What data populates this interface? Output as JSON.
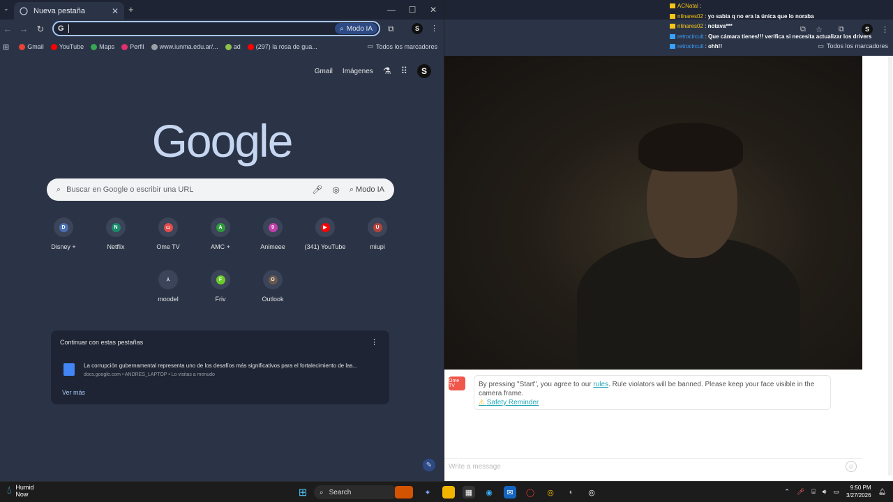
{
  "left_window": {
    "tab_title": "Nueva pestaña",
    "new_tab": "+",
    "omnibox_value": "",
    "omnibox_modo": "Modo IA",
    "bookmarks": [
      {
        "label": "Gmail",
        "color": "#ea4335"
      },
      {
        "label": "YouTube",
        "color": "#ff0000"
      },
      {
        "label": "Maps",
        "color": "#34a853"
      },
      {
        "label": "Perfil",
        "color": "#e1306c"
      },
      {
        "label": "www.iunma.edu.ar/...",
        "color": "#9aa0a6"
      },
      {
        "label": "ad",
        "color": "#8bc34a"
      },
      {
        "label": "(297) la rosa de gua...",
        "color": "#ff0000"
      }
    ],
    "all_bookmarks": "Todos los marcadores",
    "ntp": {
      "gmail": "Gmail",
      "images": "Imágenes",
      "avatar": "S",
      "logo": "Google",
      "search_placeholder": "Buscar en Google o escribir una URL",
      "search_modo": "Modo IA",
      "shortcuts": [
        {
          "label": "Disney +",
          "letter": "D",
          "color": "#4a6fb5"
        },
        {
          "label": "Netflix",
          "letter": "N",
          "color": "#1b8a6b"
        },
        {
          "label": "Ome TV",
          "letter": "▭",
          "color": "#e34b4b"
        },
        {
          "label": "AMC +",
          "letter": "A",
          "color": "#2e9a3c"
        },
        {
          "label": "Animeee",
          "letter": "9",
          "color": "#c03fa8"
        },
        {
          "label": "(341) YouTube",
          "letter": "▶",
          "color": "#ff0000"
        },
        {
          "label": "miupi",
          "letter": "U",
          "color": "#b5433b"
        },
        {
          "label": "moodel",
          "letter": "⅄",
          "color": "#3b4459"
        },
        {
          "label": "Friv",
          "letter": "F",
          "color": "#6ccc2a"
        },
        {
          "label": "Outlook",
          "letter": "O",
          "color": "#6a5a4a"
        }
      ],
      "continue": {
        "header": "Continuar con estas pestañas",
        "doc_title": "La corrupción gubernamental representa uno de los desafíos más significativos para el fortalecimiento de las...",
        "doc_sub": "docs.google.com • ANDRES_LAPTOP • Lo visitas a menudo",
        "more": "Ver más"
      }
    }
  },
  "right_window": {
    "all_bookmarks": "Todos los marcadores",
    "avatar": "S",
    "chat": [
      {
        "user": "ACNatal",
        "msg": "",
        "color": "#f5c518"
      },
      {
        "user": "nlinares02",
        "msg": "yo sabia q no era la única que lo noraba",
        "color": "#f5c518"
      },
      {
        "user": "nlinares02",
        "msg": "notava***",
        "color": "#f5c518"
      },
      {
        "user": "retrocircuit",
        "msg": "Que cámara tienes!!! verifica si necesita actualizar los drivers",
        "color": "#3aa0ff"
      },
      {
        "user": "retrocircuit",
        "msg": "ohh!!",
        "color": "#3aa0ff"
      }
    ],
    "notice": {
      "logo": "Ome TV",
      "text_before": "By pressing \"Start\", you agree to our ",
      "link": "rules",
      "text_after": ". Rule violators will be banned. Please keep your face visible in the camera frame.",
      "safety": "Safety Reminder"
    },
    "message_placeholder": "Write a message"
  },
  "taskbar": {
    "weather_title": "Humid",
    "weather_sub": "Now",
    "search": "Search",
    "time": "9:50 PM",
    "date": "3/27/2026"
  }
}
